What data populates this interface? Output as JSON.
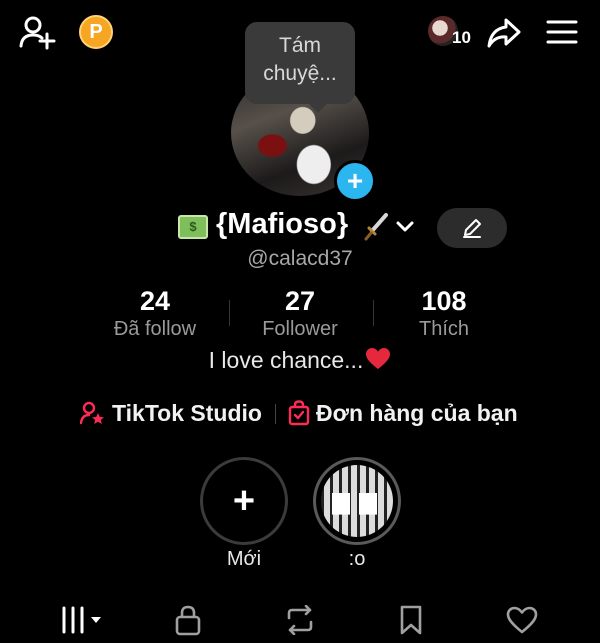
{
  "top_bar": {
    "coin_letter": "P",
    "visitor_count": "10"
  },
  "tooltip": {
    "text": "Tám chuyệ..."
  },
  "profile": {
    "display_name": "{Mafioso}",
    "handle": "@calacd37",
    "bio": "I love chance...",
    "bio_emoji": "heart"
  },
  "stats": [
    {
      "value": "24",
      "label": "Đã follow"
    },
    {
      "value": "27",
      "label": "Follower"
    },
    {
      "value": "108",
      "label": "Thích"
    }
  ],
  "links": {
    "studio": "TikTok Studio",
    "orders": "Đơn hàng của bạn"
  },
  "highlights": [
    {
      "label": "Mới"
    },
    {
      "label": ":o"
    }
  ],
  "tabs": [
    "grid",
    "private",
    "repost",
    "saved",
    "liked"
  ],
  "colors": {
    "background": "#000000",
    "accent_blue": "#2bb6f0",
    "link_icon_red": "#fe2c55",
    "coin": "#f6a623",
    "heart": "#e6283c"
  }
}
